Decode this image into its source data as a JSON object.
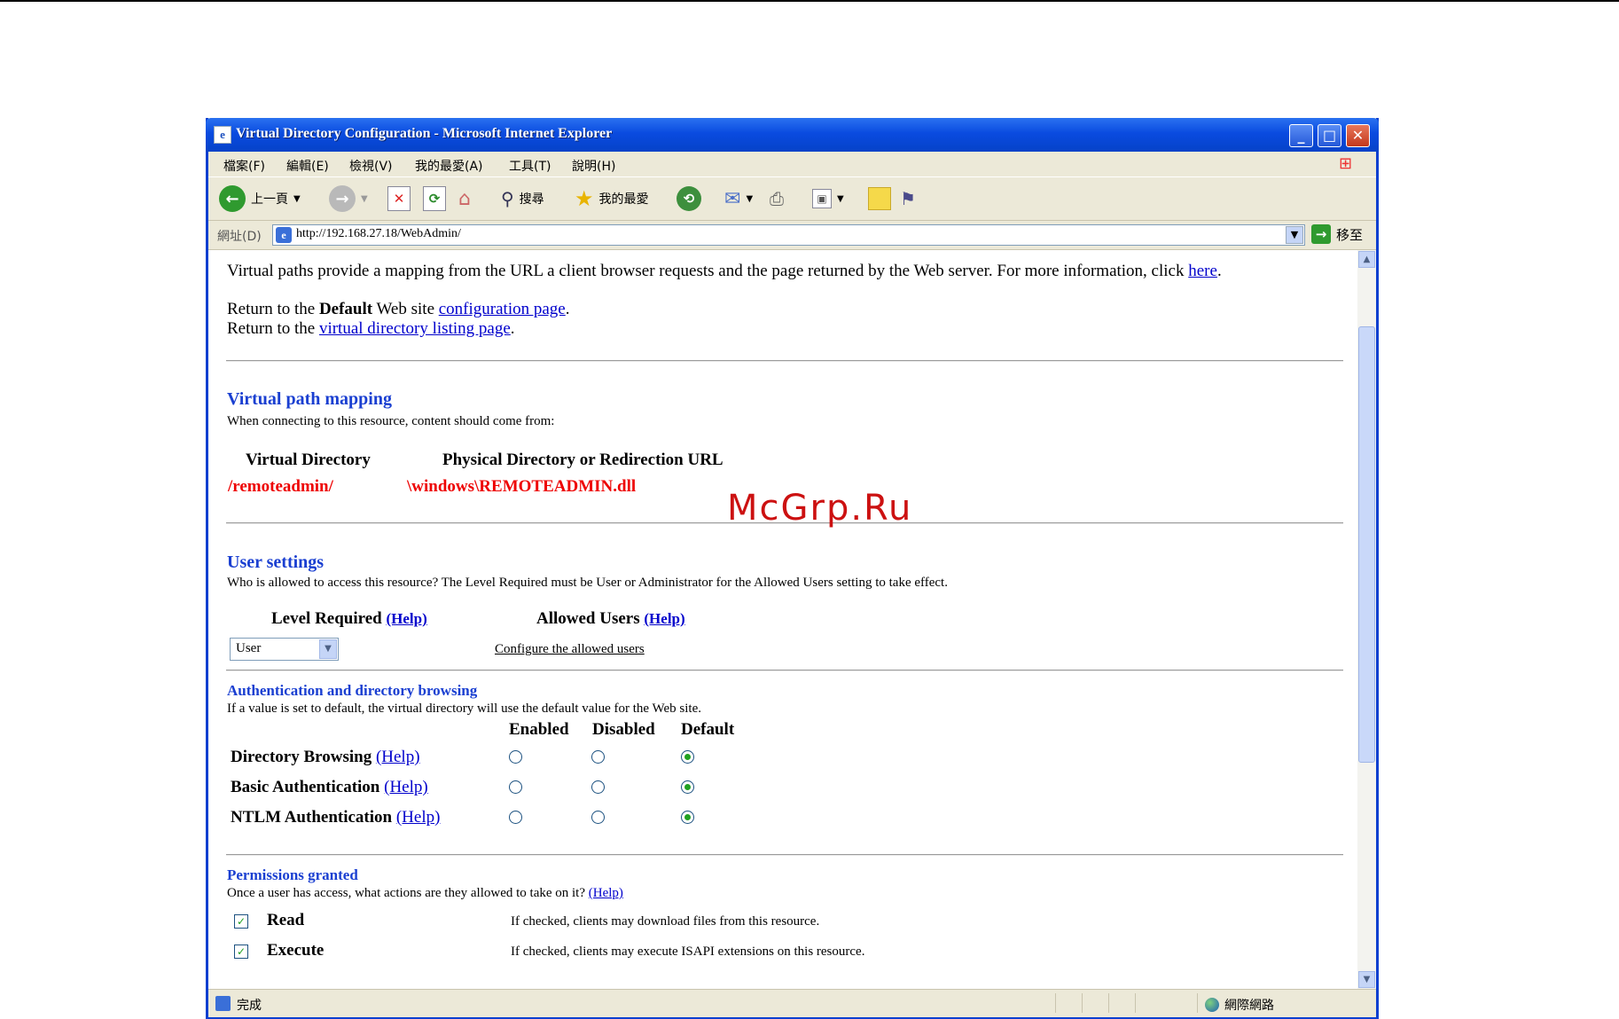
{
  "watermark": "McGrp.Ru",
  "window": {
    "title": "Virtual Directory Configuration - Microsoft Internet Explorer",
    "minimize": "_",
    "maximize": "□",
    "close": "✕"
  },
  "menu": [
    "檔案(F)",
    "編輯(E)",
    "檢視(V)",
    "我的最愛(A)",
    "工具(T)",
    "說明(H)"
  ],
  "toolbar": {
    "back": "上一頁",
    "search": "搜尋",
    "favorites": "我的最愛"
  },
  "address": {
    "label": "網址(D)",
    "url": "http://192.168.27.18/WebAdmin/",
    "go": "移至"
  },
  "page": {
    "intro_text": "Virtual paths provide a mapping from the URL a client browser requests and the page returned by the Web server. For more information, click ",
    "intro_link": "here",
    "return1_prefix": "Return to the ",
    "return1_bold": "Default",
    "return1_mid": " Web site ",
    "return1_link": "configuration page",
    "return2_prefix": "Return to the ",
    "return2_link": "virtual directory listing page",
    "period": ".",
    "vpm_heading": "Virtual path mapping",
    "vpm_sub": "When connecting to this resource, content should come from:",
    "col_virtual": "Virtual Directory",
    "col_physical": "Physical Directory or Redirection URL",
    "virtual_value": "/remoteadmin/",
    "physical_value": "\\windows\\REMOTEADMIN.dll",
    "user_heading": "User settings",
    "user_sub": "Who is allowed to access this resource? The Level Required must be User or Administrator for the Allowed Users setting to take effect.",
    "level_label": "Level Required",
    "allowed_label": "Allowed Users",
    "help": "(Help)",
    "level_value": "User",
    "configure_link": "Configure the allowed users",
    "auth_heading": "Authentication and directory browsing",
    "auth_sub": "If a value is set to default, the virtual directory will use the default value for the Web site.",
    "col_enabled": "Enabled",
    "col_disabled": "Disabled",
    "col_default": "Default",
    "row_dir": "Directory Browsing",
    "row_basic": "Basic Authentication",
    "row_ntlm": "NTLM Authentication",
    "perm_heading": "Permissions granted",
    "perm_sub": "Once a user has access, what actions are they allowed to take on it?",
    "perm_read": "Read",
    "perm_read_desc": "If checked, clients may download files from this resource.",
    "perm_execute": "Execute",
    "perm_execute_desc": "If checked, clients may execute ISAPI extensions on this resource."
  },
  "status": {
    "text": "完成",
    "zone": "網際網路"
  }
}
